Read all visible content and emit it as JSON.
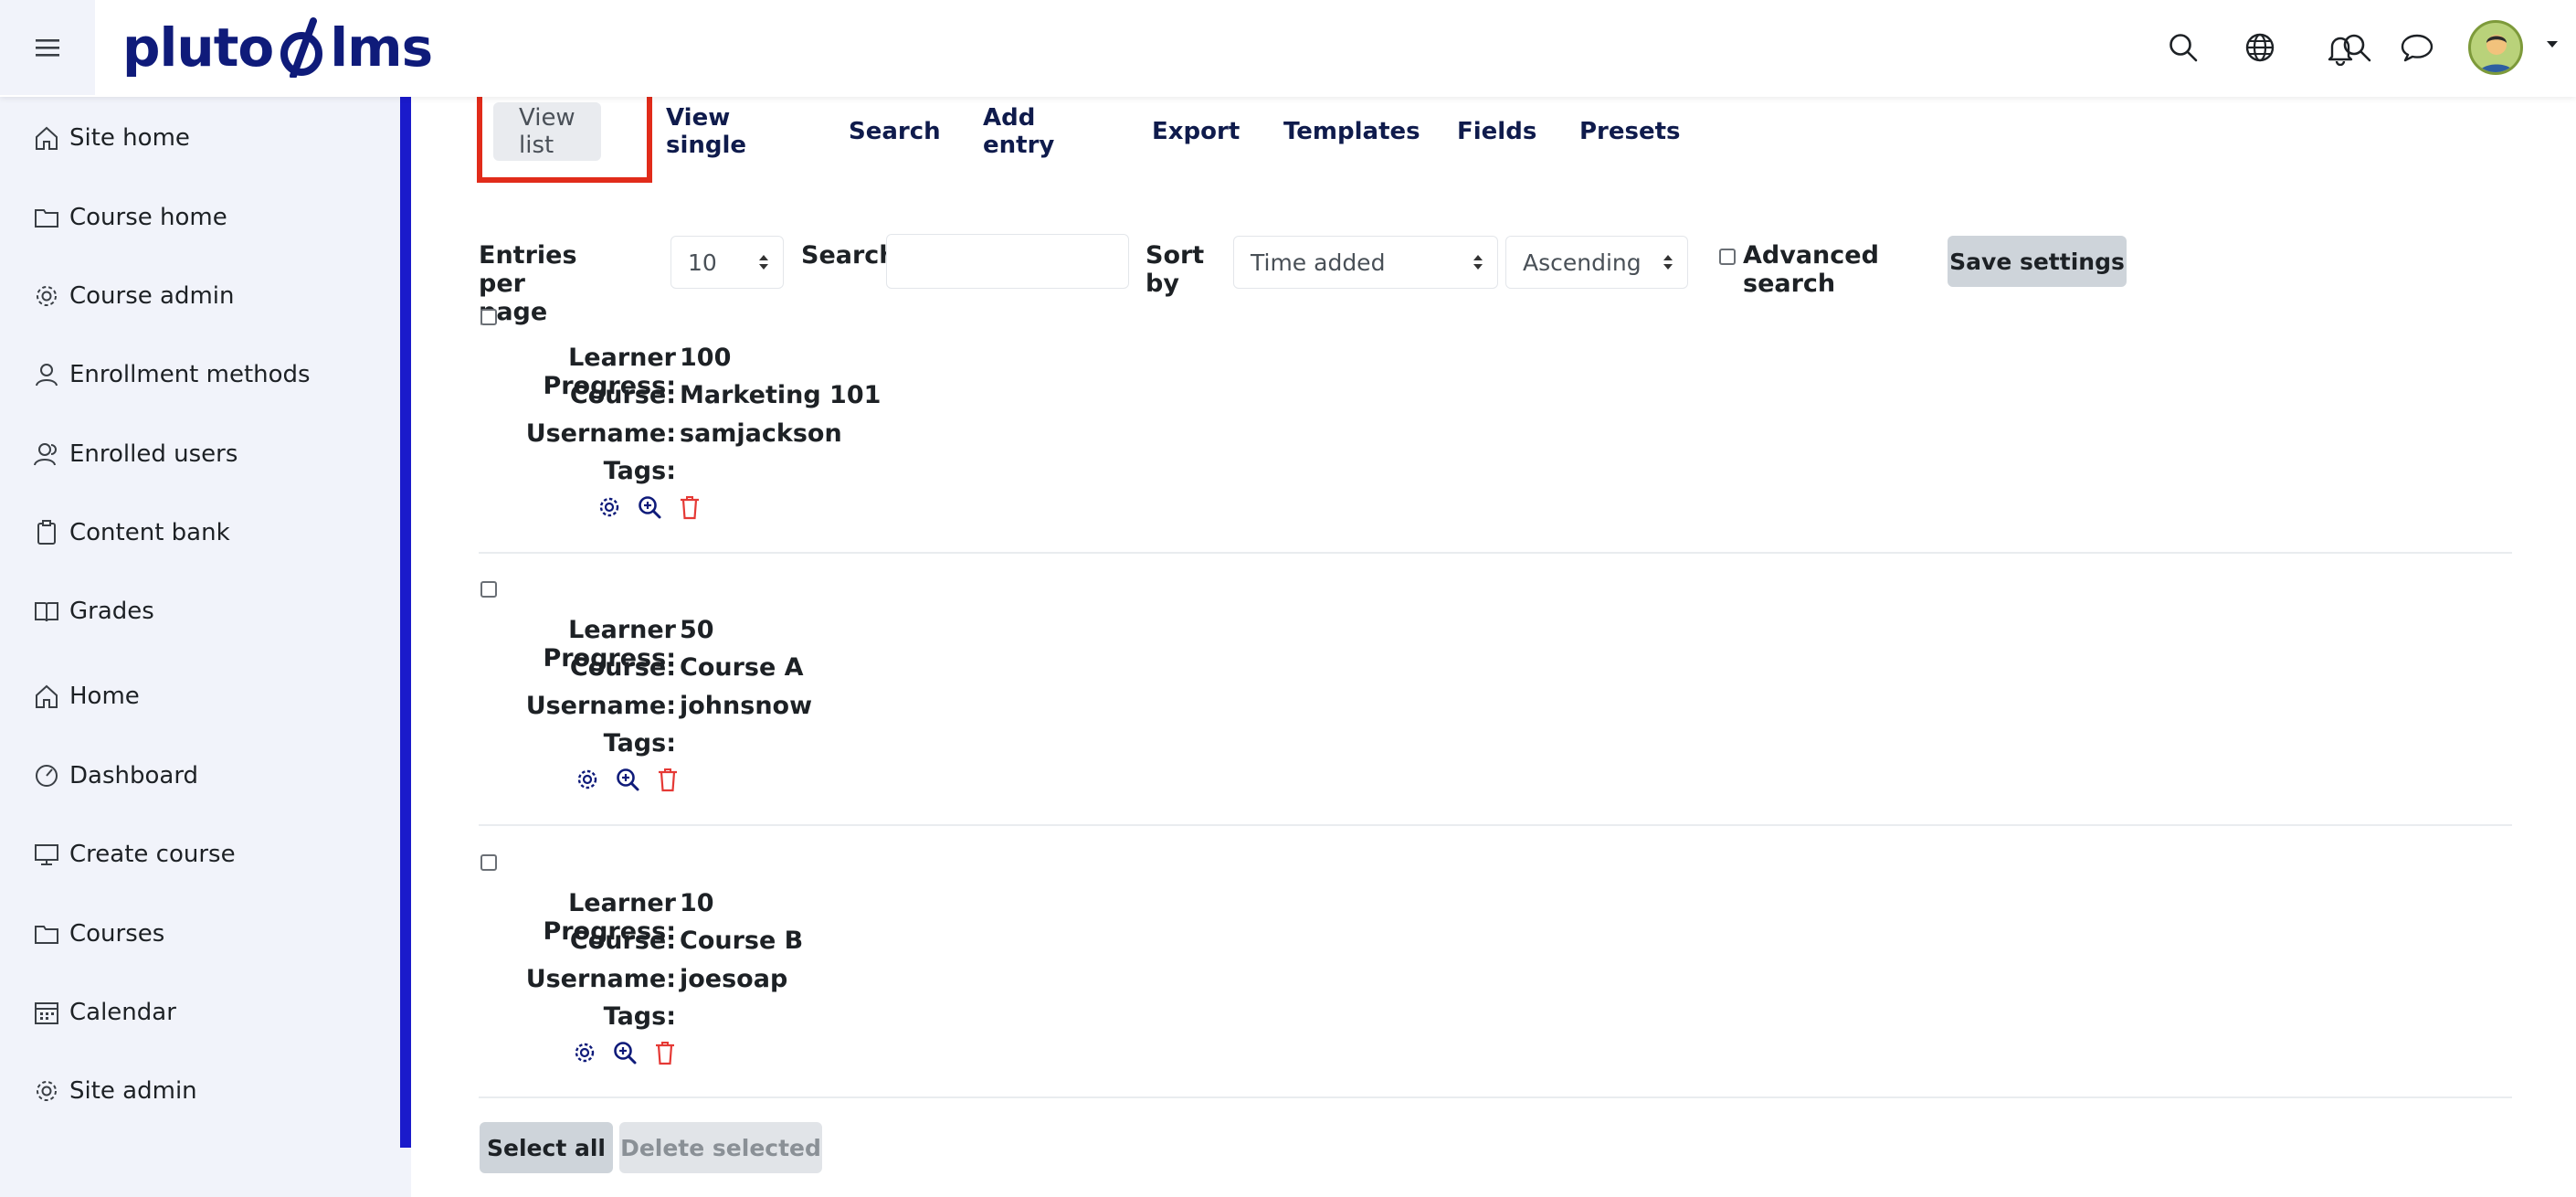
{
  "brand": {
    "logo_text_left": "pluto",
    "logo_text_right": "lms"
  },
  "colors": {
    "brand": "#0f1b7a",
    "accent": "#1a1acb",
    "highlight": "#e12b1a",
    "delete_icon": "#e53935"
  },
  "navbar": {
    "icons": [
      "search-icon",
      "globe-icon",
      "bell-icon",
      "chat-icon"
    ]
  },
  "sidebar": {
    "items": [
      {
        "label": "Site home",
        "icon": "home-icon"
      },
      {
        "label": "Course home",
        "icon": "folder-icon"
      },
      {
        "label": "Course admin",
        "icon": "gear-icon"
      },
      {
        "label": "Enrollment methods",
        "icon": "user-icon"
      },
      {
        "label": "Enrolled users",
        "icon": "users-icon"
      },
      {
        "label": "Content bank",
        "icon": "clipboard-icon"
      },
      {
        "label": "Grades",
        "icon": "book-icon"
      },
      {
        "label": "Home",
        "icon": "home-icon"
      },
      {
        "label": "Dashboard",
        "icon": "gauge-icon"
      },
      {
        "label": "Create course",
        "icon": "monitor-icon"
      },
      {
        "label": "Courses",
        "icon": "folder-icon"
      },
      {
        "label": "Calendar",
        "icon": "calendar-icon"
      },
      {
        "label": "Site admin",
        "icon": "gear-icon"
      }
    ]
  },
  "tabs": [
    {
      "label": "View list",
      "active": true
    },
    {
      "label": "View single"
    },
    {
      "label": "Search"
    },
    {
      "label": "Add entry"
    },
    {
      "label": "Export"
    },
    {
      "label": "Templates"
    },
    {
      "label": "Fields"
    },
    {
      "label": "Presets"
    }
  ],
  "controls": {
    "entries_label": "Entries per page",
    "entries_value": "10",
    "search_label": "Search",
    "search_value": "",
    "sort_label": "Sort by",
    "sort_value": "Time added",
    "order_value": "Ascending",
    "advanced_label": "Advanced search",
    "save_label": "Save settings"
  },
  "field_labels": {
    "progress": "Learner Progress:",
    "course": "Course:",
    "username": "Username:",
    "tags": "Tags:"
  },
  "entries": [
    {
      "progress": "100",
      "course": "Marketing 101",
      "username": "samjackson",
      "tags": ""
    },
    {
      "progress": "50",
      "course": "Course A",
      "username": "johnsnow",
      "tags": ""
    },
    {
      "progress": "10",
      "course": "Course B",
      "username": "joesoap",
      "tags": ""
    }
  ],
  "footer": {
    "select_all": "Select all",
    "delete_selected": "Delete selected"
  }
}
